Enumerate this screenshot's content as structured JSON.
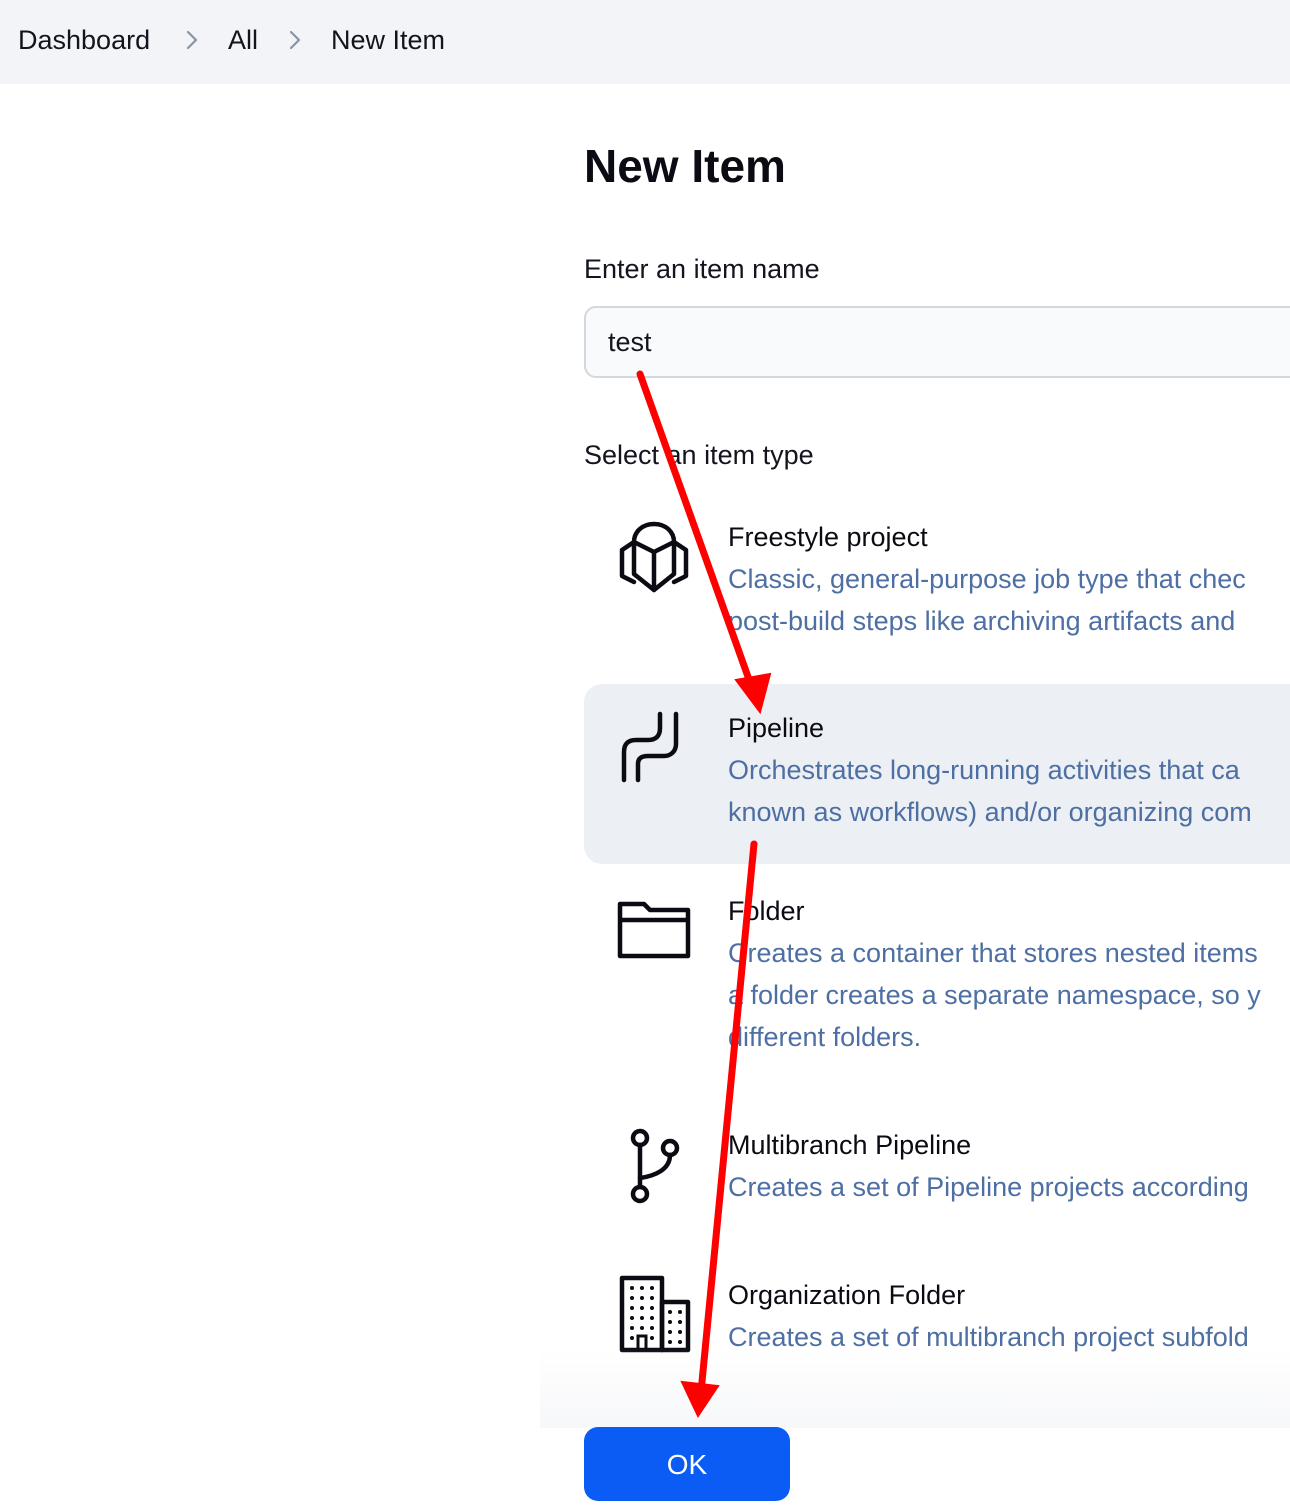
{
  "breadcrumb": {
    "items": [
      "Dashboard",
      "All",
      "New Item"
    ]
  },
  "page": {
    "title": "New Item"
  },
  "name_field": {
    "label": "Enter an item name",
    "value": "test"
  },
  "type_section": {
    "label": "Select an item type",
    "selected": "Pipeline",
    "items": [
      {
        "label": "Freestyle project",
        "desc1": "Classic, general-purpose job type that chec",
        "desc2": "post-build steps like archiving artifacts and",
        "icon": "cube-icon"
      },
      {
        "label": "Pipeline",
        "desc1": "Orchestrates long-running activities that ca",
        "desc2": "known as workflows) and/or organizing com",
        "icon": "pipeline-icon"
      },
      {
        "label": "Folder",
        "desc1": "Creates a container that stores nested items",
        "desc2": "a folder creates a separate namespace, so y",
        "desc3": "different folders.",
        "icon": "folder-icon"
      },
      {
        "label": "Multibranch Pipeline",
        "desc1": "Creates a set of Pipeline projects according",
        "icon": "branch-icon"
      },
      {
        "label": "Organization Folder",
        "desc1": "Creates a set of multibranch project subfold",
        "icon": "buildings-icon"
      }
    ]
  },
  "actions": {
    "ok_label": "OK"
  },
  "colors": {
    "accent": "#0b5cf5",
    "description_text": "#4d6fa3",
    "selected_row_bg": "#eceff4",
    "annotation_arrow": "#ff0000"
  }
}
